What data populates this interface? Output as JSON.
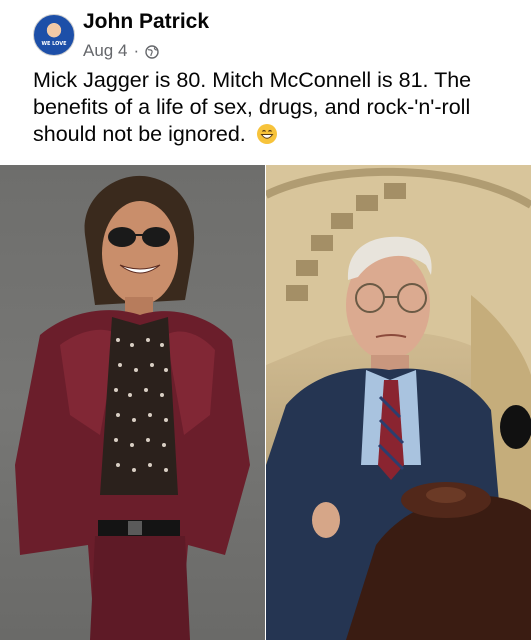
{
  "post": {
    "author": "John Patrick",
    "avatar_text": "WE LOVE",
    "date": "Aug 4",
    "separator": "·",
    "audience_icon": "globe-icon",
    "text": "Mick Jagger is 80. Mitch McConnell is 81. The benefits of a life of sex, drugs, and rock-'n'-roll should not be ignored.",
    "emoji": "grinning-face-icon"
  },
  "photos": {
    "left_icon": "rock-star-photo",
    "right_icon": "politician-photo"
  }
}
